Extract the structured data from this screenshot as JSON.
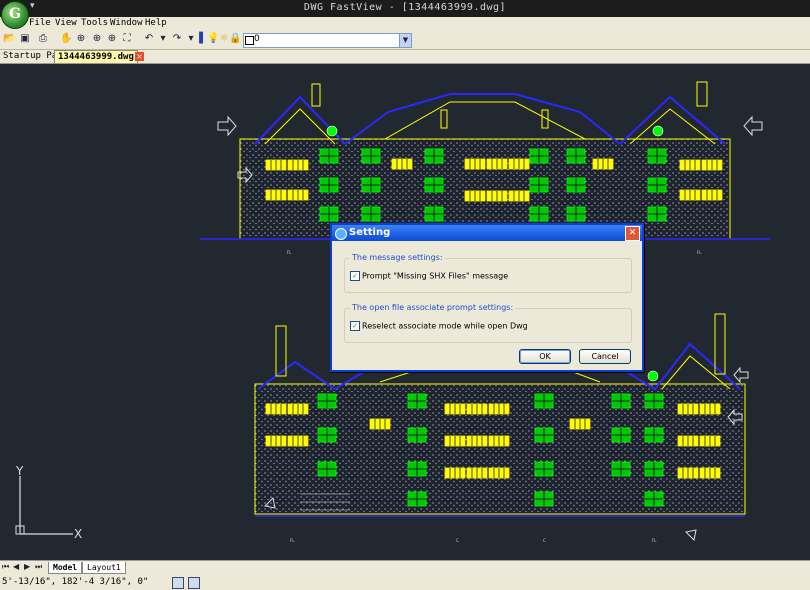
{
  "window": {
    "title": "DWG FastView - [1344463999.dwg]"
  },
  "menu": [
    "File",
    "View",
    "Tools",
    "Window",
    "Help"
  ],
  "layer": {
    "value": "0"
  },
  "tabs": [
    {
      "label": "Startup Page"
    },
    {
      "label": "1344463999.dwg"
    }
  ],
  "layout_tabs": [
    "Model",
    "Layout1"
  ],
  "canvas": {
    "axis_y": "Y",
    "axis_x": "X",
    "labels": [
      "FL",
      "FL",
      "FL",
      "FL",
      "C",
      "C"
    ]
  },
  "status": {
    "coords": "5'-13/16\", 182'-4 3/16\", 0\""
  },
  "dialog": {
    "title": "Setting",
    "group1": {
      "title": "The message settings:",
      "option": "Prompt \"Missing SHX Files\" message",
      "checked": true
    },
    "group2": {
      "title": "The open file associate prompt settings:",
      "option": "Reselect associate mode while open Dwg",
      "checked": true
    },
    "ok": "OK",
    "cancel": "Cancel"
  },
  "colors": {
    "accent": "#0a4ad6",
    "drawing_yellow": "#ffff00",
    "drawing_green": "#00dd00",
    "drawing_blue": "#2828ff"
  }
}
